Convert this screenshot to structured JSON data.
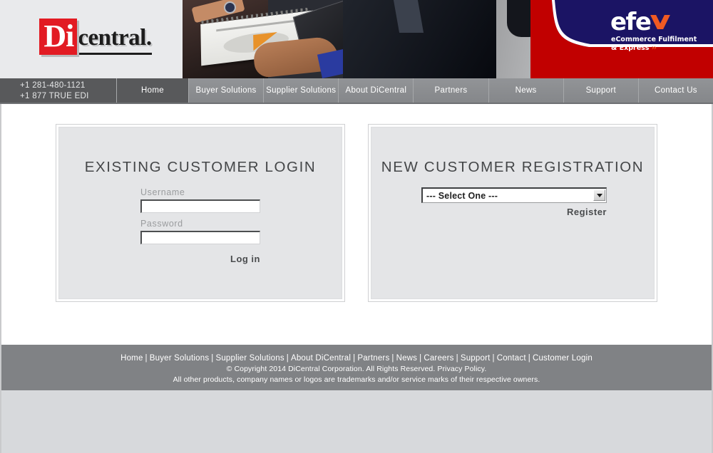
{
  "brand": {
    "logo_prefix": "Di",
    "logo_suffix": "central.",
    "watermark_word": "efe",
    "watermark_tagline_line1": "eCommerce Fulfilment",
    "watermark_tagline_line2": "& Express",
    "watermark_chevrons": "››",
    "colors": {
      "logo_red": "#e21b23",
      "watermark_navy": "#1b1464",
      "watermark_red": "#c10000",
      "watermark_orange": "#f15a22",
      "nav_bar": "#8b8d90",
      "nav_active": "#58595b",
      "footer_bar": "#808285",
      "panel_fill": "#e4e5e7"
    }
  },
  "nav": {
    "phone_primary": "+1 281-480-1121",
    "phone_secondary": "+1 877 TRUE EDI",
    "items": [
      {
        "label": "Home",
        "active": true
      },
      {
        "label": "Buyer Solutions",
        "active": false
      },
      {
        "label": "Supplier Solutions",
        "active": false
      },
      {
        "label": "About DiCentral",
        "active": false
      },
      {
        "label": "Partners",
        "active": false
      },
      {
        "label": "News",
        "active": false
      },
      {
        "label": "Support",
        "active": false
      },
      {
        "label": "Contact Us",
        "active": false
      }
    ]
  },
  "login_panel": {
    "title": "EXISTING CUSTOMER LOGIN",
    "username_label": "Username",
    "username_value": "",
    "username_placeholder": "",
    "password_label": "Password",
    "password_value": "",
    "password_placeholder": "",
    "submit_label": "Log in"
  },
  "registration_panel": {
    "title": "NEW CUSTOMER REGISTRATION",
    "select_value": "--- Select One ---",
    "select_options": [
      "--- Select One ---"
    ],
    "register_label": "Register"
  },
  "footer": {
    "links": [
      "Home",
      "Buyer Solutions",
      "Supplier Solutions",
      "About DiCentral",
      "Partners",
      "News",
      "Careers",
      "Support",
      "Contact",
      "Customer Login"
    ],
    "separator": "|",
    "copyright": "© Copyright 2014 DiCentral Corporation. All Rights Reserved. Privacy Policy.",
    "trademark": "All other products, company names or logos are trademarks and/or service marks of their respective owners."
  }
}
